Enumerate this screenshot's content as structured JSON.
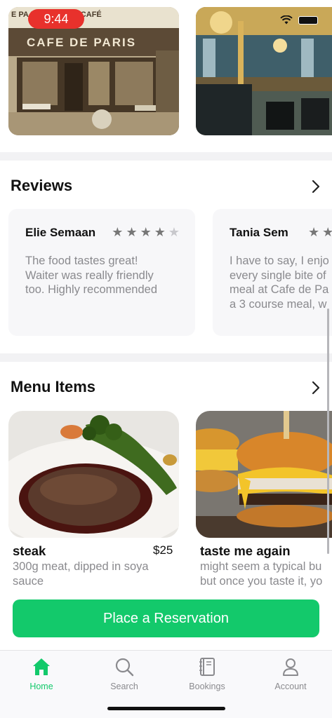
{
  "status_bar": {
    "time": "9:44"
  },
  "gallery": [
    {
      "name": "Cafe de Paris storefront",
      "sign": "CAFE DE PARIS",
      "top_sign": "E PA   FÉ DE PARIS  CAFÉ"
    },
    {
      "name": "Cafe interior"
    }
  ],
  "reviews": {
    "title": "Reviews",
    "items": [
      {
        "author": "Elie Semaan",
        "rating": 4,
        "lines": [
          "The food tastes great!",
          "Waiter was really friendly",
          "too. Highly recommended"
        ]
      },
      {
        "author": "Tania Sem",
        "rating": 2,
        "lines": [
          "I have to say, I enjo",
          "every single bite of",
          "meal at Cafe de Pa",
          "a 3 course meal, w"
        ]
      }
    ]
  },
  "menu": {
    "title": "Menu Items",
    "items": [
      {
        "name": "steak",
        "price": "$25",
        "lines": [
          "300g meat, dipped in soya",
          "sauce"
        ]
      },
      {
        "name": "taste me again",
        "price": "",
        "lines": [
          "might seem a typical bu",
          "but once you taste it, yo"
        ]
      }
    ]
  },
  "reserve_button": "Place a Reservation",
  "tabs": [
    {
      "label": "Home",
      "icon": "home-icon",
      "active": true
    },
    {
      "label": "Search",
      "icon": "search-icon",
      "active": false
    },
    {
      "label": "Bookings",
      "icon": "bookings-icon",
      "active": false
    },
    {
      "label": "Account",
      "icon": "account-icon",
      "active": false
    }
  ],
  "colors": {
    "accent": "#13c96b",
    "status_pill": "#e8312c"
  }
}
